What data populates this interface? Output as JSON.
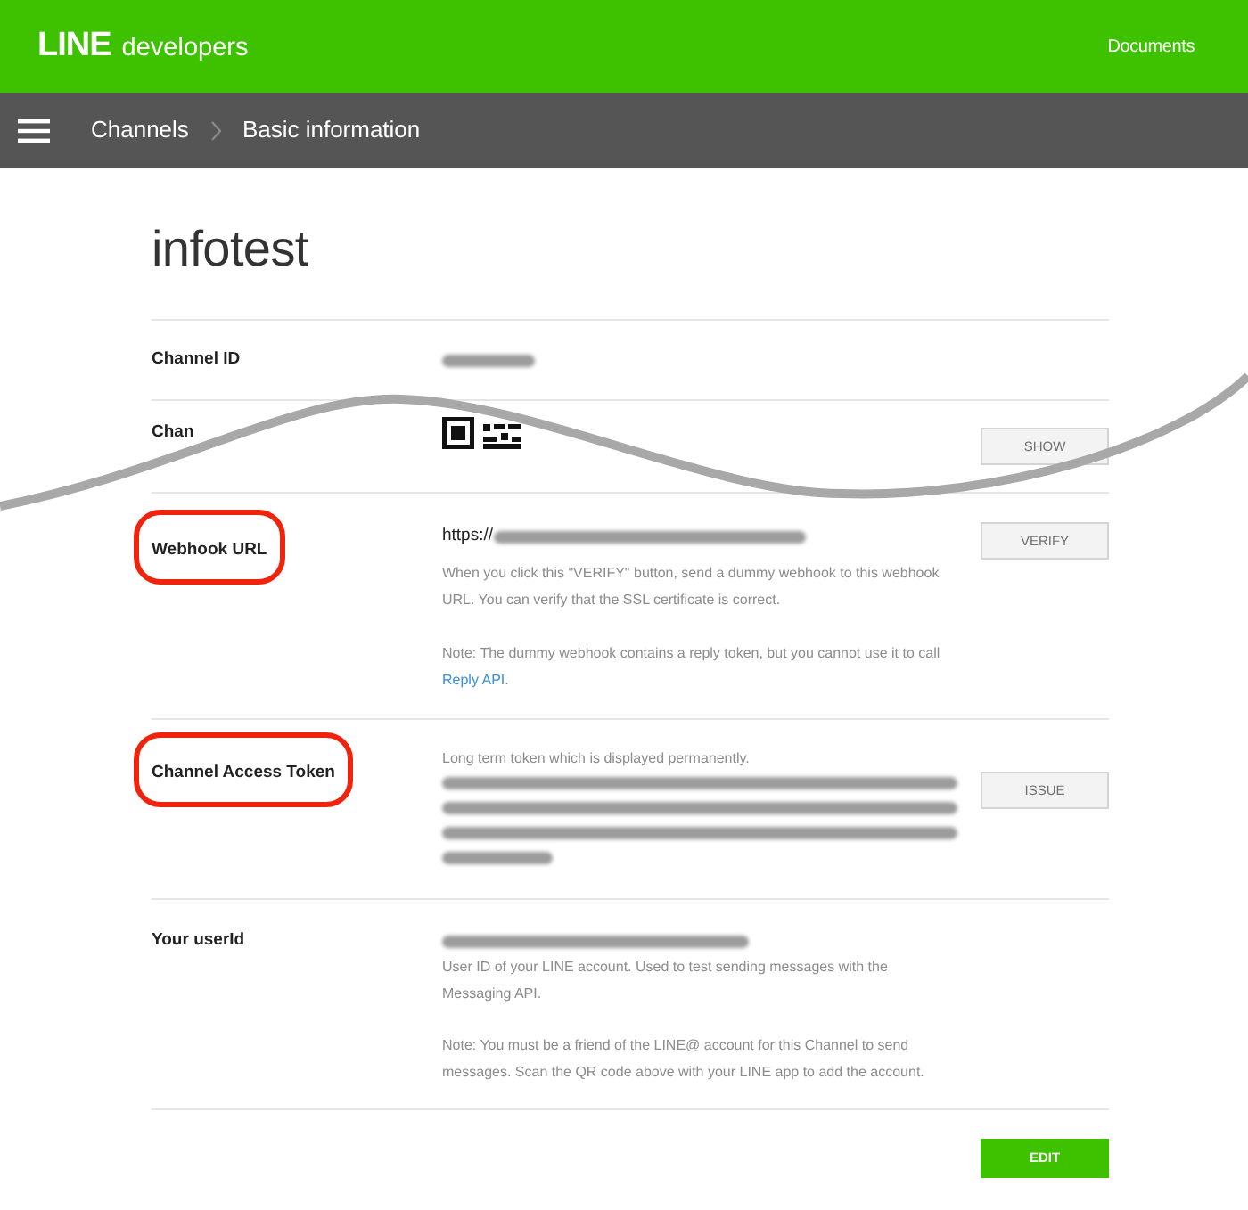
{
  "header": {
    "logo": {
      "wordmark": "LINE",
      "product": "developers"
    },
    "nav_links": [
      "Documents"
    ]
  },
  "breadcrumb": [
    "Channels",
    "Basic information"
  ],
  "title": "infotest",
  "rows": [
    {
      "kind": "id",
      "label": "Channel ID",
      "highlighted": false,
      "value": {
        "redacted": true
      }
    },
    {
      "kind": "qr",
      "label": "Chan",
      "highlighted": false,
      "button": "SHOW"
    },
    {
      "kind": "url",
      "label": "Webhook URL",
      "highlighted": true,
      "value": {
        "text": "https://",
        "redacted": true
      },
      "button": "VERIFY",
      "notes": [
        {
          "text": "When you click this \"VERIFY\" button, send a dummy webhook to this webhook URL. You can verify that the SSL certificate is correct."
        },
        {
          "text": "Note: The dummy webhook contains a reply token, but you cannot use it to call ",
          "link": "Reply API",
          "after": "."
        }
      ]
    },
    {
      "kind": "token",
      "label": "Channel Access Token",
      "highlighted": true,
      "hint": "Long term token which is displayed permanently.",
      "value": {
        "redacted": true
      },
      "button": "ISSUE"
    },
    {
      "kind": "user",
      "label": "Your userId",
      "highlighted": false,
      "value": {
        "redacted": true
      },
      "notes": [
        {
          "text": "User ID of your LINE account. Used to test sending messages with the Messaging API."
        },
        {
          "text": "Note: You must be a friend of the LINE@ account for this Channel to send messages. Scan the QR code above with your LINE app to add the account."
        }
      ]
    }
  ],
  "actions": [
    {
      "label": "EDIT",
      "kind": "primary"
    }
  ]
}
